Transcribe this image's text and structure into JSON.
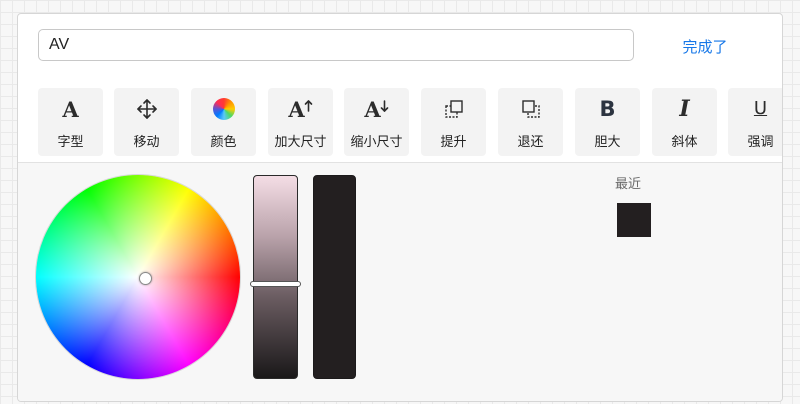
{
  "editor": {
    "text_value": "AV",
    "done_label": "完成了"
  },
  "toolbar": {
    "tools": [
      {
        "id": "font",
        "label": "字型",
        "glyph": "A",
        "icon": "font-icon"
      },
      {
        "id": "move",
        "label": "移动",
        "glyph": "",
        "icon": "move-arrows-icon"
      },
      {
        "id": "color",
        "label": "颜色",
        "glyph": "",
        "icon": "color-palette-icon"
      },
      {
        "id": "increase-size",
        "label": "加大尺寸",
        "glyph": "A",
        "icon": "increase-size-icon"
      },
      {
        "id": "decrease-size",
        "label": "缩小尺寸",
        "glyph": "A",
        "icon": "decrease-size-icon"
      },
      {
        "id": "bring-forward",
        "label": "提升",
        "glyph": "",
        "icon": "bring-forward-icon"
      },
      {
        "id": "send-backward",
        "label": "退还",
        "glyph": "",
        "icon": "send-backward-icon"
      },
      {
        "id": "bold",
        "label": "胆大",
        "glyph": "B",
        "icon": "bold-icon"
      },
      {
        "id": "italic",
        "label": "斜体",
        "glyph": "I",
        "icon": "italic-icon"
      },
      {
        "id": "underline",
        "label": "强调",
        "glyph": "U",
        "icon": "underline-icon"
      }
    ]
  },
  "color_picker": {
    "current_color": "#231f20",
    "shade_level": 0.53,
    "recent_label": "最近",
    "recent_colors": [
      "#231f20"
    ]
  },
  "colors": {
    "accent": "#1677e8"
  }
}
